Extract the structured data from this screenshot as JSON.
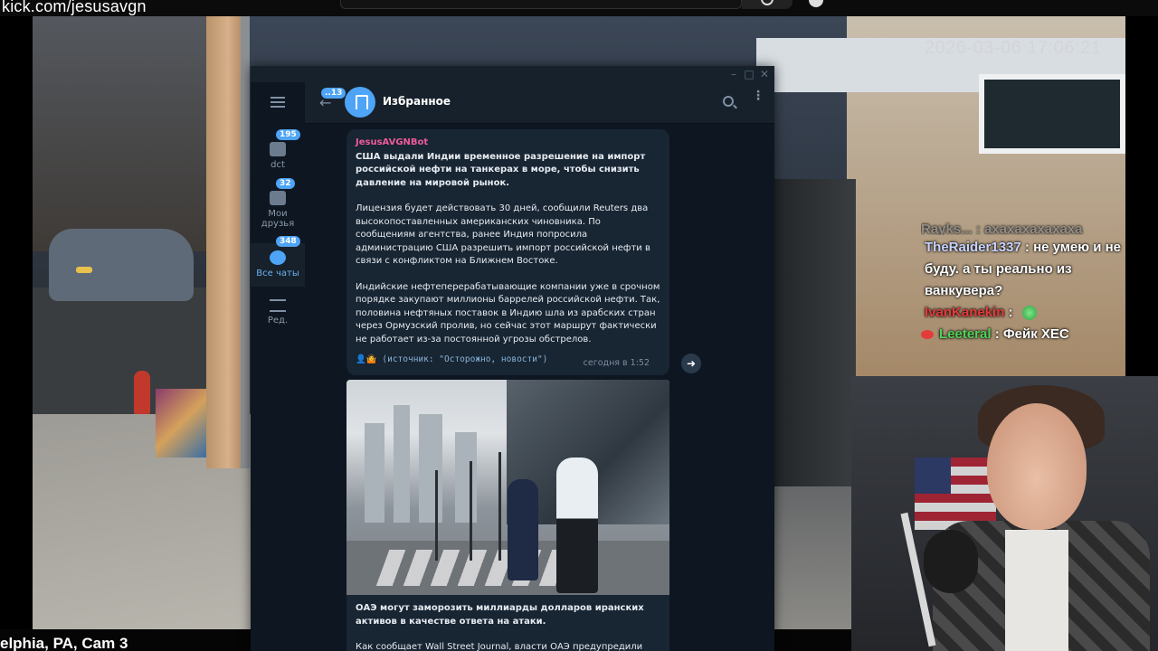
{
  "stream": {
    "url": "kick.com/jesusavgn",
    "camera_label": "elphia, PA, Cam 3",
    "cam_timestamp": "2026-03-06 17:06:21"
  },
  "chat": {
    "cut_line": "Rayks... : ахахахахахаха",
    "messages": [
      {
        "user": "TheRaider1337",
        "text": ": не умею и не буду. а ты реально из ванкувера?"
      },
      {
        "user": "IvanKanekin",
        "text": ":"
      },
      {
        "user": "Leeteral",
        "text": ": Фейк ХЕС"
      }
    ]
  },
  "telegram": {
    "chat_title": "Избранное",
    "back_badge": "..13",
    "folders": [
      {
        "label": "dct",
        "badge": "195"
      },
      {
        "label": "Мои друзья",
        "badge": "32"
      },
      {
        "label": "Все чаты",
        "badge": "348"
      },
      {
        "label": "Ред.",
        "badge": ""
      }
    ],
    "message1": {
      "sender": "JesusAVGNBot",
      "headline": "США выдали Индии временное разрешение на импорт российской нефти на танкерах в море, чтобы снизить давление на мировой рынок.",
      "para1": "Лицензия будет действовать 30 дней, сообщили Reuters два высокопоставленных американских чиновника. По сообщениям агентства, ранее Индия попросила администрацию США разрешить импорт российской нефти в связи с конфликтом на Ближнем Востоке.",
      "para2": "Индийские нефтеперерабатывающие компании уже в срочном порядке закупают миллионы баррелей российской нефти. Так, половина нефтяных поставок в Индию шла из арабских стран через Ормузский пролив, но сейчас этот маршрут фактически не работает из-за постоянной угрозы обстрелов.",
      "source": "👤🤷 (источник: \"Осторожно, новости\")",
      "time": "сегодня в 1:52"
    },
    "message2": {
      "headline": "ОАЭ могут заморозить миллиарды долларов иранских активов в качестве ответа на атаки.",
      "para1": "Как сообщает Wall Street Journal, власти ОАЭ предупредили"
    }
  }
}
